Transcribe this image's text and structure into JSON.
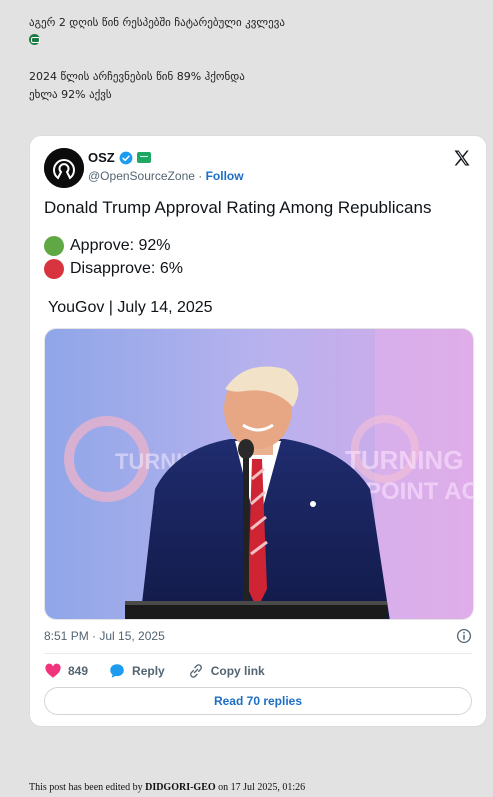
{
  "post": {
    "line1": "აგერ 2 დღის წინ რესპებში ჩატარებული კვლევა",
    "line2": "2024 წლის არჩევნების წინ 89% ჰქონდა",
    "line3": "ეხლა 92% აქვს"
  },
  "tweet": {
    "author_name": "OSZ",
    "handle": "@OpenSourceZone",
    "separator": " · ",
    "follow_label": "Follow",
    "title": "Donald Trump Approval Rating Among Republicans",
    "approve_text": "Approve: 92%",
    "disapprove_text": "Disapprove: 6%",
    "source_text": "YouGov | July 14, 2025",
    "timestamp": "8:51 PM · Jul 15, 2025",
    "likes_count": "849",
    "reply_label": "Reply",
    "copy_link_label": "Copy link",
    "read_replies_label": "Read 70 replies",
    "colors": {
      "approve": "#5fa845",
      "disapprove": "#d8343f",
      "link": "#1d6ec5",
      "like": "#f0357c",
      "verified": "#1d9bf0"
    }
  },
  "footer": {
    "edited_prefix": "This post has been edited by ",
    "editor": "DIDGORI-GEO",
    "edited_suffix": " on 17 Jul 2025, 01:26"
  }
}
